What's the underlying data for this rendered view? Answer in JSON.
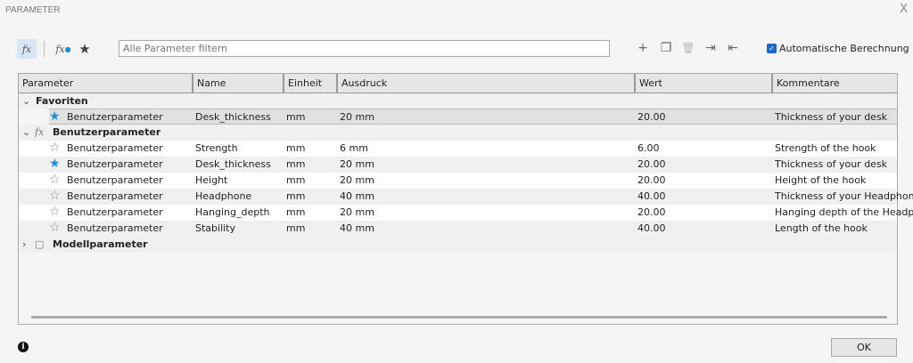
{
  "window": {
    "title": "PARAMETER",
    "close": "X"
  },
  "toolbar": {
    "fx": "fx",
    "fx_user": "fx",
    "favorites": "★",
    "filter_placeholder": "Alle Parameter filtern",
    "add": "+",
    "copy": "❐",
    "delete": "🗑",
    "import": "⇥",
    "export": "⇤",
    "auto_calc_label": "Automatische Berechnung",
    "auto_calc_checked": true
  },
  "columns": [
    "Parameter",
    "Name",
    "Einheit",
    "Ausdruck",
    "Wert",
    "Kommentare"
  ],
  "groups": {
    "favorites": "Favoriten",
    "user": "Benutzerparameter",
    "model": "Modellparameter"
  },
  "favorites": [
    {
      "type": "Benutzerparameter",
      "name": "Desk_thickness",
      "unit": "mm",
      "expr": "20 mm",
      "value": "20.00",
      "comment": "Thickness of your desk",
      "fav": true
    }
  ],
  "user_params": [
    {
      "type": "Benutzerparameter",
      "name": "Strength",
      "unit": "mm",
      "expr": "6 mm",
      "value": "6.00",
      "comment": "Strength of the hook",
      "fav": false
    },
    {
      "type": "Benutzerparameter",
      "name": "Desk_thickness",
      "unit": "mm",
      "expr": "20 mm",
      "value": "20.00",
      "comment": "Thickness of your desk",
      "fav": true
    },
    {
      "type": "Benutzerparameter",
      "name": "Height",
      "unit": "mm",
      "expr": "20 mm",
      "value": "20.00",
      "comment": "Height of the hook",
      "fav": false
    },
    {
      "type": "Benutzerparameter",
      "name": "Headphone",
      "unit": "mm",
      "expr": "40 mm",
      "value": "40.00",
      "comment": "Thickness of your Headphone",
      "fav": false
    },
    {
      "type": "Benutzerparameter",
      "name": "Hanging_depth",
      "unit": "mm",
      "expr": "20 mm",
      "value": "20.00",
      "comment": "Hanging depth of the Headphone",
      "fav": false
    },
    {
      "type": "Benutzerparameter",
      "name": "Stability",
      "unit": "mm",
      "expr": "40 mm",
      "value": "40.00",
      "comment": "Length of the hook",
      "fav": false
    }
  ],
  "footer": {
    "ok": "OK",
    "info": "i"
  },
  "colors": {
    "accent": "#1a8fd6",
    "checkbox": "#1b6ac9"
  }
}
